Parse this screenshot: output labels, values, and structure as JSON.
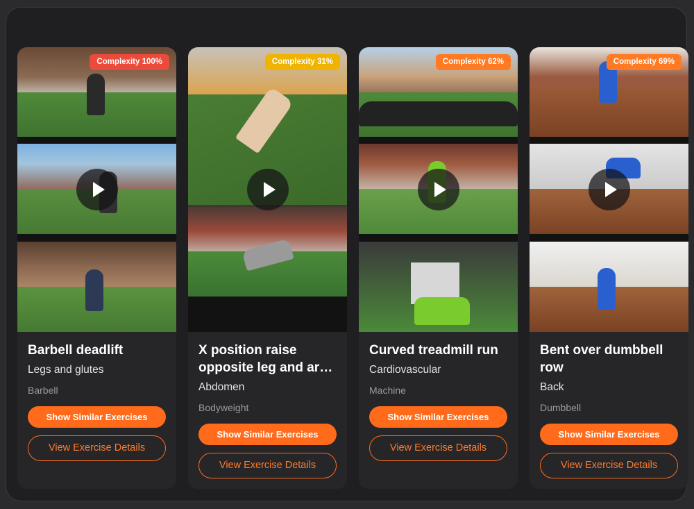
{
  "colors": {
    "accent": "#ff6b1a",
    "badge_high": "#ec4a3a",
    "badge_low": "#f0b400",
    "badge_mid": "#ff7a22"
  },
  "cards": [
    {
      "title": "Barbell deadlift",
      "muscle": "Legs and glutes",
      "equipment": "Barbell",
      "complexity": "Complexity 100%",
      "similar_label": "Show Similar Exercises",
      "details_label": "View Exercise Details",
      "play_icon": "play-icon"
    },
    {
      "title": "X position raise",
      "title_line2": "opposite leg and ar…",
      "muscle": "Abdomen",
      "equipment": "Bodyweight",
      "complexity": "Complexity 31%",
      "similar_label": "Show Similar Exercises",
      "details_label": "View Exercise Details",
      "play_icon": "play-icon"
    },
    {
      "title": "Curved treadmill run",
      "muscle": "Cardiovascular",
      "equipment": "Machine",
      "complexity": "Complexity 62%",
      "similar_label": "Show Similar Exercises",
      "details_label": "View Exercise Details",
      "play_icon": "play-icon"
    },
    {
      "title": "Bent over dumbbell",
      "title_line2": "row",
      "muscle": "Back",
      "equipment": "Dumbbell",
      "complexity": "Complexity 69%",
      "similar_label": "Show Similar Exercises",
      "details_label": "View Exercise Details",
      "play_icon": "play-icon"
    }
  ]
}
